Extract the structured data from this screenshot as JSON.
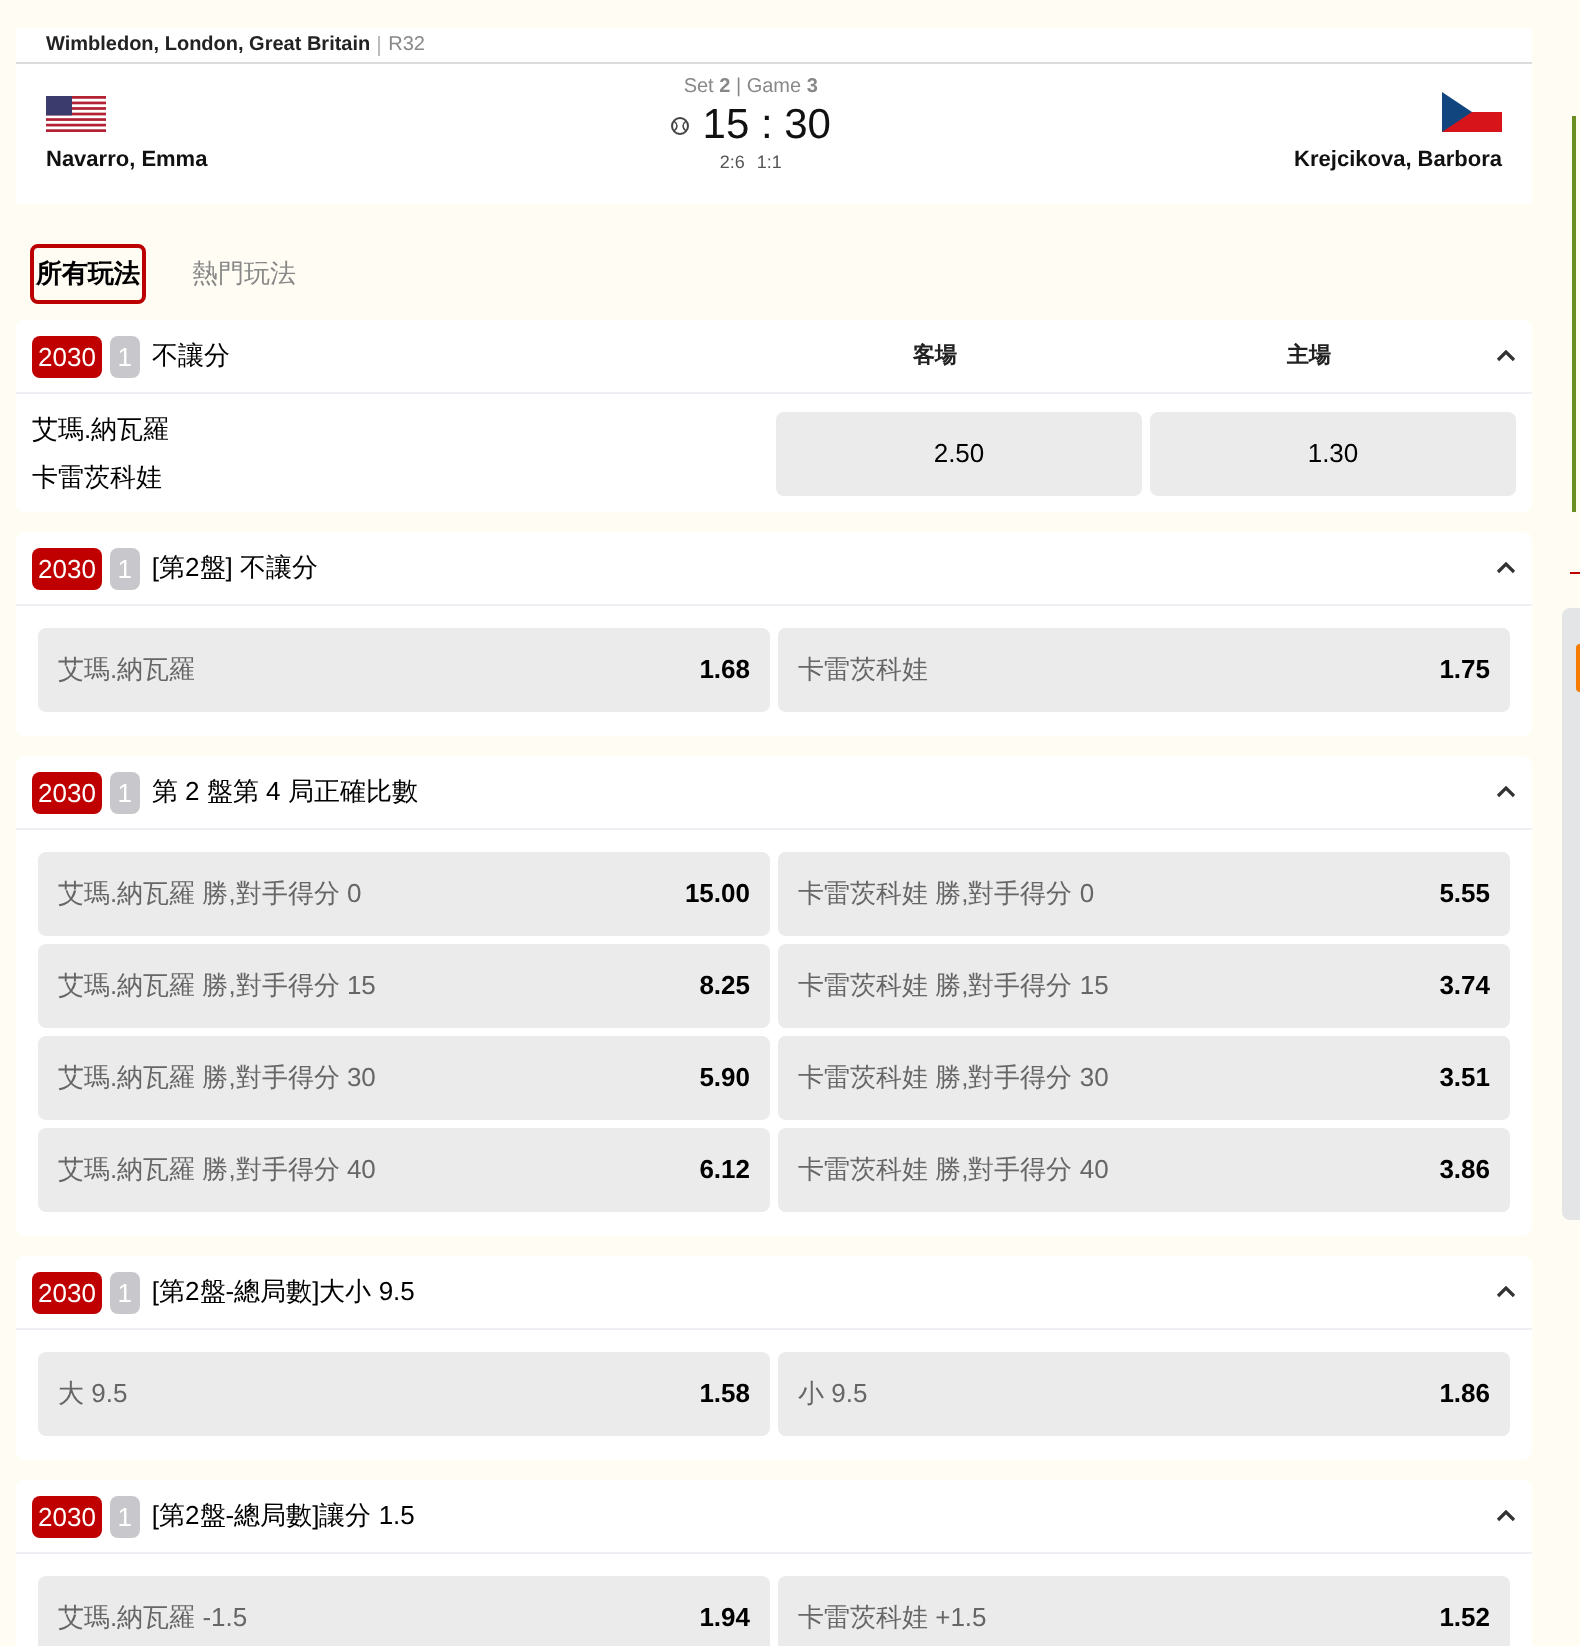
{
  "match": {
    "tournament": "Wimbledon, London, Great Britain",
    "round": "R32",
    "period": "Set **2** | Game **3**",
    "score": "15 : 30",
    "sets": "2:6",
    "games": "1:1",
    "home": {
      "name": "Navarro, Emma",
      "serving": true
    },
    "away": {
      "name": "Krejcikova, Barbora",
      "serving": false
    }
  },
  "tabs": [
    {
      "label": "所有玩法",
      "selected": true
    },
    {
      "label": "熱門玩法",
      "selected": false
    }
  ],
  "markets": [
    {
      "kind": "columns",
      "code": "2030",
      "count": "1",
      "title": "不讓分",
      "expanded": true,
      "columns": [
        "客場",
        "主場"
      ],
      "players": [
        "艾瑪.納瓦羅",
        "卡雷茨科娃"
      ],
      "odds": [
        "2.50",
        "1.30"
      ]
    },
    {
      "kind": "grid",
      "code": "2030",
      "count": "1",
      "title": "[第2盤] 不讓分",
      "expanded": true,
      "selections": [
        {
          "label": "艾瑪.納瓦羅",
          "odds": "1.68"
        },
        {
          "label": "卡雷茨科娃",
          "odds": "1.75"
        }
      ]
    },
    {
      "kind": "grid",
      "code": "2030",
      "count": "1",
      "title": "第 2 盤第 4 局正確比數",
      "expanded": true,
      "selections": [
        {
          "label": "艾瑪.納瓦羅 勝,對手得分 0",
          "odds": "15.00"
        },
        {
          "label": "卡雷茨科娃 勝,對手得分 0",
          "odds": "5.55"
        },
        {
          "label": "艾瑪.納瓦羅 勝,對手得分 15",
          "odds": "8.25"
        },
        {
          "label": "卡雷茨科娃 勝,對手得分 15",
          "odds": "3.74"
        },
        {
          "label": "艾瑪.納瓦羅 勝,對手得分 30",
          "odds": "5.90"
        },
        {
          "label": "卡雷茨科娃 勝,對手得分 30",
          "odds": "3.51"
        },
        {
          "label": "艾瑪.納瓦羅 勝,對手得分 40",
          "odds": "6.12"
        },
        {
          "label": "卡雷茨科娃 勝,對手得分 40",
          "odds": "3.86"
        }
      ]
    },
    {
      "kind": "grid",
      "code": "2030",
      "count": "1",
      "title": "[第2盤-總局數]大小 9.5",
      "expanded": true,
      "selections": [
        {
          "label": "大 9.5",
          "odds": "1.58"
        },
        {
          "label": "小 9.5",
          "odds": "1.86"
        }
      ]
    },
    {
      "kind": "grid",
      "code": "2030",
      "count": "1",
      "title": "[第2盤-總局數]讓分 1.5",
      "expanded": true,
      "selections": [
        {
          "label": "艾瑪.納瓦羅 -1.5",
          "odds": "1.94"
        },
        {
          "label": "卡雷茨科娃 +1.5",
          "odds": "1.52"
        }
      ]
    }
  ]
}
